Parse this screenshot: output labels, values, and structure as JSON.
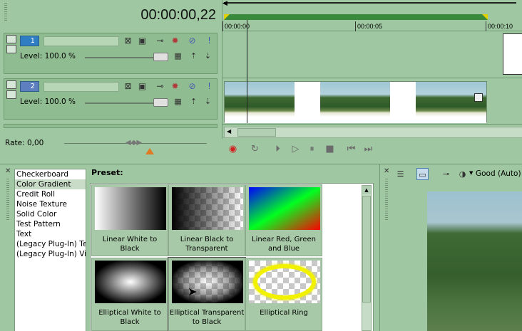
{
  "timecode": "00:00:00,22",
  "ruler": {
    "ticks": [
      "00:00:00",
      "00:00:05",
      "00:00:10"
    ]
  },
  "tracks": [
    {
      "number": "1",
      "level_label": "Level: 100.0 %"
    },
    {
      "number": "2",
      "level_label": "Level: 100.0 %"
    }
  ],
  "rate": {
    "label": "Rate: 0,00"
  },
  "plugins": {
    "items": [
      "Checkerboard",
      "Color Gradient",
      "Credit Roll",
      "Noise Texture",
      "Solid Color",
      "Test Pattern",
      "Text",
      "(Legacy Plug-In) Text",
      "(Legacy Plug-In) Video"
    ],
    "selected": "Color Gradient"
  },
  "presets": {
    "label": "Preset:",
    "items": [
      {
        "name": "Linear White to Black"
      },
      {
        "name": "Linear Black to Transparent"
      },
      {
        "name": "Linear Red, Green and Blue"
      },
      {
        "name": "Elliptical White to Black"
      },
      {
        "name": "Elliptical Transparent to Black"
      },
      {
        "name": "Elliptical Ring"
      }
    ]
  },
  "preview": {
    "quality": "Good (Auto)"
  },
  "colors": {
    "track1": "#2f7dc2",
    "track2": "#5d7fbf",
    "loop_bar": "#3a8a3e",
    "record": "#d02020"
  }
}
